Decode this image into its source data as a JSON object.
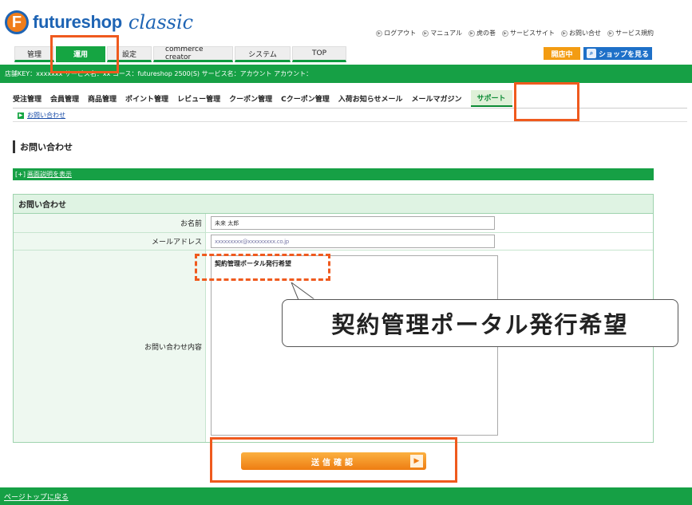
{
  "brand": {
    "mark": "F",
    "name": "futureshop",
    "suffix": "classic"
  },
  "top_links": [
    "ログアウト",
    "マニュアル",
    "虎の巻",
    "サービスサイト",
    "お問い合せ",
    "サービス規約"
  ],
  "tabs": [
    "管理",
    "運用",
    "設定",
    "commerce creator",
    "システム",
    "TOP"
  ],
  "right_buttons": {
    "open": "開店中",
    "shop": "ショップを見る"
  },
  "shop_info": "店舗KEY：xxxxxxx  サービス名：xx  コース：futureshop 2500(S)  サービス名：アカウント  アカウント：",
  "subnav": [
    "受注管理",
    "会員管理",
    "商品管理",
    "ポイント管理",
    "レビュー管理",
    "クーポン管理",
    "Cクーポン管理",
    "入荷お知らせメール",
    "メールマガジン",
    "サポート"
  ],
  "breadcrumb": "お問い合わせ",
  "page_title": "お問い合わせ",
  "help": {
    "prefix": "[+]",
    "link": "画面説明を表示"
  },
  "form": {
    "heading": "お問い合わせ",
    "name_label": "お名前",
    "name_value": "未来 太郎",
    "email_label": "メールアドレス",
    "email_value": "xxxxxxxxx@xxxxxxxxx.co.jp",
    "content_label": "お問い合わせ内容",
    "content_value": "契約管理ポータル発行希望"
  },
  "submit_label": "送信確認",
  "footer_link": "ページトップに戻る",
  "callout_text": "契約管理ポータル発行希望",
  "colors": {
    "green": "#16a045",
    "orange": "#ef5a1e",
    "blue": "#1e64b4"
  }
}
